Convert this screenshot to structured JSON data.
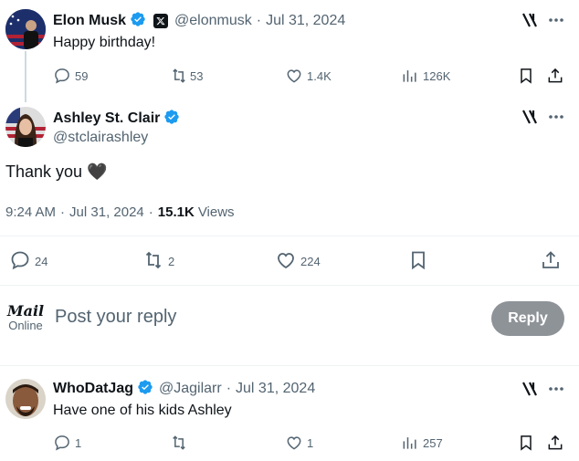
{
  "tweet1": {
    "name": "Elon Musk",
    "handle": "@elonmusk",
    "date": "Jul 31, 2024",
    "sep": "·",
    "text": "Happy birthday!",
    "actions": {
      "replies": "59",
      "reposts": "53",
      "likes": "1.4K",
      "views": "126K"
    }
  },
  "tweet2": {
    "name": "Ashley St. Clair",
    "handle": "@stclairashley",
    "text": "Thank you 🖤",
    "time": "9:24 AM",
    "date": "Jul 31, 2024",
    "views_count": "15.1K",
    "views_label": "Views",
    "sep": "·",
    "actions": {
      "replies": "24",
      "reposts": "2",
      "likes": "224"
    }
  },
  "reply_box": {
    "logo_top": "Mail",
    "logo_bottom": "Online",
    "placeholder": "Post your reply",
    "button": "Reply"
  },
  "tweet3": {
    "name": "WhoDatJag",
    "handle": "@Jagilarr",
    "date": "Jul 31, 2024",
    "sep": "·",
    "text": "Have one of his kids Ashley",
    "actions": {
      "replies": "1",
      "reposts": "",
      "likes": "1",
      "views": "257"
    }
  },
  "colors": {
    "verified": "#1d9bf0",
    "text": "#0f1419",
    "muted": "#536471",
    "reply_button": "#8e9398"
  },
  "icons": [
    "verified-badge-icon",
    "x-logo-icon",
    "grok-icon",
    "more-icon",
    "reply-icon",
    "repost-icon",
    "like-icon",
    "views-icon",
    "bookmark-icon",
    "share-icon"
  ]
}
